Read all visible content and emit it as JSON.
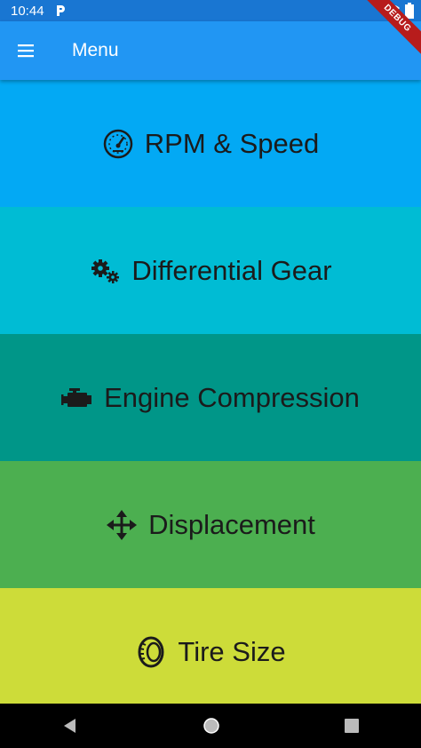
{
  "status_bar": {
    "time": "10:44",
    "carrier_icon": "p-icon",
    "wifi_icon": "wifi-icon",
    "battery_icon": "battery-icon"
  },
  "debug_banner": "DEBUG",
  "app_bar": {
    "menu_icon": "menu-icon",
    "title": "Menu"
  },
  "menu_items": [
    {
      "label": "RPM & Speed",
      "icon": "speedometer-icon",
      "color": "#03A9F4"
    },
    {
      "label": "Differential Gear",
      "icon": "gears-icon",
      "color": "#00BCD4"
    },
    {
      "label": "Engine Compression",
      "icon": "engine-icon",
      "color": "#009688"
    },
    {
      "label": "Displacement",
      "icon": "move-arrows-icon",
      "color": "#4CAF50"
    },
    {
      "label": "Tire Size",
      "icon": "tire-icon",
      "color": "#CDDC39"
    }
  ],
  "nav_bar": {
    "back_icon": "back-icon",
    "home_icon": "home-icon",
    "recents_icon": "recents-icon"
  }
}
